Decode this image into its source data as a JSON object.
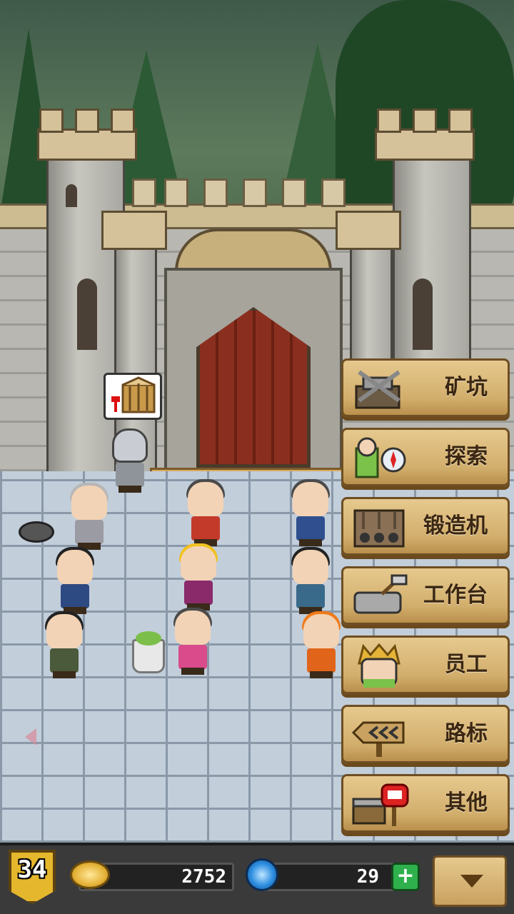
{
  "menu": {
    "items": [
      {
        "label": "矿坑",
        "icon": "mine-icon"
      },
      {
        "label": "探索",
        "icon": "explore-compass-icon"
      },
      {
        "label": "锻造机",
        "icon": "forge-machine-icon"
      },
      {
        "label": "工作台",
        "icon": "workbench-icon"
      },
      {
        "label": "员工",
        "icon": "staff-icon"
      },
      {
        "label": "路标",
        "icon": "signpost-icon"
      },
      {
        "label": "其他",
        "icon": "mailbox-chest-icon"
      }
    ]
  },
  "status": {
    "level": "34",
    "coins": "2752",
    "gems": "29",
    "add_label": "+"
  },
  "colors": {
    "menu_wood": "#d2ae6c",
    "gold": "#e5b72c",
    "gem_blue": "#2d8ee0",
    "add_green": "#2eb04c"
  }
}
